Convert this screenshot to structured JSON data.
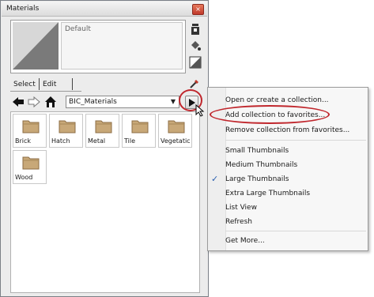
{
  "window": {
    "title": "Materials",
    "close_glyph": "×"
  },
  "preview": {
    "material_name": "Default",
    "swatch_colors": {
      "light": "#d7d7d7",
      "dark": "#7a7a7a"
    },
    "side_icons": [
      "create-material-icon",
      "paint-bucket-icon",
      "default-swatch-icon"
    ]
  },
  "tabs": {
    "select": "Select",
    "edit": "Edit",
    "tool_icon": "eyedropper-icon"
  },
  "nav": {
    "collection": "BIC_Materials",
    "icons": [
      "back-arrow-icon",
      "forward-arrow-icon",
      "home-icon"
    ]
  },
  "materials": [
    {
      "label": "Brick"
    },
    {
      "label": "Hatch"
    },
    {
      "label": "Metal"
    },
    {
      "label": "Tile"
    },
    {
      "label": "Vegetatic"
    },
    {
      "label": "Wood"
    }
  ],
  "menu": {
    "items": [
      {
        "label": "Open or create a collection...",
        "checked": false
      },
      {
        "label": "Add collection to favorites...",
        "checked": false
      },
      {
        "label": "Remove collection from favorites...",
        "checked": false
      },
      {
        "label": "Small Thumbnails",
        "checked": false
      },
      {
        "label": "Medium Thumbnails",
        "checked": false
      },
      {
        "label": "Large Thumbnails",
        "checked": true
      },
      {
        "label": "Extra Large Thumbnails",
        "checked": false
      },
      {
        "label": "List View",
        "checked": false
      },
      {
        "label": "Refresh",
        "checked": false
      },
      {
        "label": "Get More...",
        "checked": false
      }
    ],
    "check_glyph": "✓"
  },
  "colors": {
    "highlight": "#c0272d",
    "folder": "#c8a878",
    "accent": "#2a5fb0"
  }
}
